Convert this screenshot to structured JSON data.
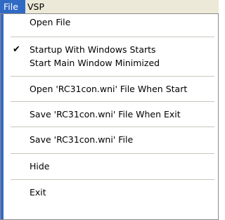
{
  "menubar": {
    "file_label": "File",
    "vsp_label": "VSP"
  },
  "menu": {
    "items": [
      {
        "label": "Open File",
        "checked": false
      },
      {
        "label": "Startup With Windows Starts",
        "checked": true,
        "check_glyph": "✔"
      },
      {
        "label": "Start Main Window Minimized",
        "checked": false
      },
      {
        "label": "Open 'RC31con.wni' File When Start",
        "checked": false
      },
      {
        "label": "Save 'RC31con.wni' File When Exit",
        "checked": false
      },
      {
        "label": "Save 'RC31con.wni' File",
        "checked": false
      },
      {
        "label": "Hide",
        "checked": false
      },
      {
        "label": "Exit",
        "checked": false
      }
    ]
  },
  "colors": {
    "highlight": "#316ac5",
    "menubar_bg": "#ece9d8",
    "separator": "#c8c6bd"
  }
}
